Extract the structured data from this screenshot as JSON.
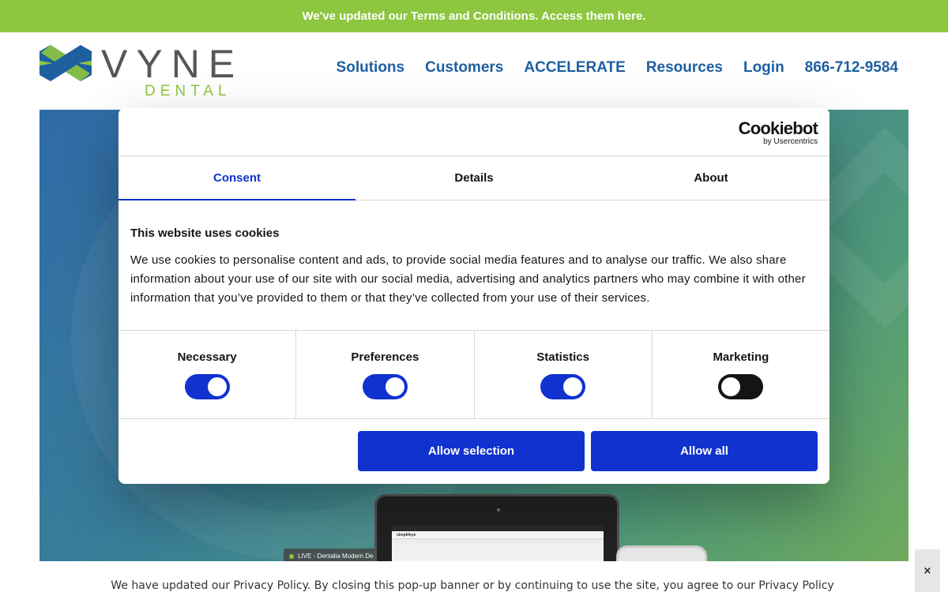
{
  "top_bar": {
    "text": "We've updated our Terms and Conditions. Access them here."
  },
  "header": {
    "logo": {
      "word": "VYNE",
      "sub": "DENTAL",
      "colors": {
        "blue": "#1e5fa0",
        "green": "#8dc63f",
        "gray": "#575757"
      }
    },
    "nav": [
      {
        "label": "Solutions"
      },
      {
        "label": "Customers"
      },
      {
        "label": "ACCELERATE"
      },
      {
        "label": "Resources"
      },
      {
        "label": "Login"
      },
      {
        "label": "866-712-9584"
      }
    ]
  },
  "hero": {
    "screen_title": "simplifeye",
    "live_tag": "LIVE - Dentalia Modern De"
  },
  "cookie_dialog": {
    "brand": {
      "name": "Cookiebot",
      "sub": "by Usercentrics"
    },
    "tabs": [
      {
        "label": "Consent",
        "active": true
      },
      {
        "label": "Details",
        "active": false
      },
      {
        "label": "About",
        "active": false
      }
    ],
    "heading": "This website uses cookies",
    "body": "We use cookies to personalise content and ads, to provide social media features and to analyse our traffic. We also share information about your use of our site with our social media, advertising and analytics partners who may combine it with other information that you’ve provided to them or that they’ve collected from your use of their services.",
    "toggles": [
      {
        "label": "Necessary",
        "on": true
      },
      {
        "label": "Preferences",
        "on": true
      },
      {
        "label": "Statistics",
        "on": true
      },
      {
        "label": "Marketing",
        "on": false
      }
    ],
    "buttons": {
      "allow_selection": "Allow selection",
      "allow_all": "Allow all"
    },
    "accent": "#1032cf"
  },
  "privacy_notice": {
    "text": "We have updated our Privacy Policy. By closing this pop-up banner or by continuing to use the site, you agree to our Privacy Policy",
    "close_label": "×"
  }
}
